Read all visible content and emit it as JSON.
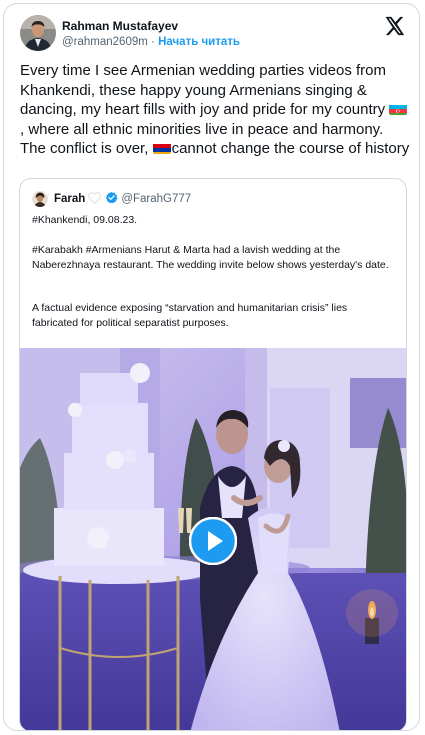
{
  "author": {
    "name": "Rahman Mustafayev",
    "handle": "@rahman2609m",
    "separator": " · ",
    "follow_label": "Начать читать"
  },
  "tweet": {
    "text_main": "Every time I see Armenian wedding parties videos from Khankendi, these happy young Armenians singing & dancing, my heart fills with joy and pride for my country ",
    "text_mid": ", where all ethnic minorities live in peace and harmony. The conflict is over, ",
    "text_end": "cannot change the course of history",
    "flag_1": "azerbaijan-flag-icon",
    "flag_2": "armenia-flag-icon"
  },
  "quote": {
    "name": "Farah",
    "handle": "@FarahG777",
    "line1": "#Khankendi, 09.08.23.",
    "para2": "#Karabakh #Armenians Harut & Marta had a lavish wedding at the Naberezhnaya restaurant. The wedding invite below shows yesterday's date.",
    "para3": "A factual evidence exposing  “starvation and humanitarian crisis” lies fabricated for political separatist purposes."
  },
  "icons": {
    "x_logo": "x-logo-icon",
    "heart": "white-heart-icon",
    "verified": "verified-badge-icon",
    "play": "play-icon"
  },
  "colors": {
    "link_blue": "#1d9bf0",
    "text": "#0f1419",
    "muted": "#536471",
    "border": "#cfd9de",
    "video_tint": "#7a6fd4"
  }
}
